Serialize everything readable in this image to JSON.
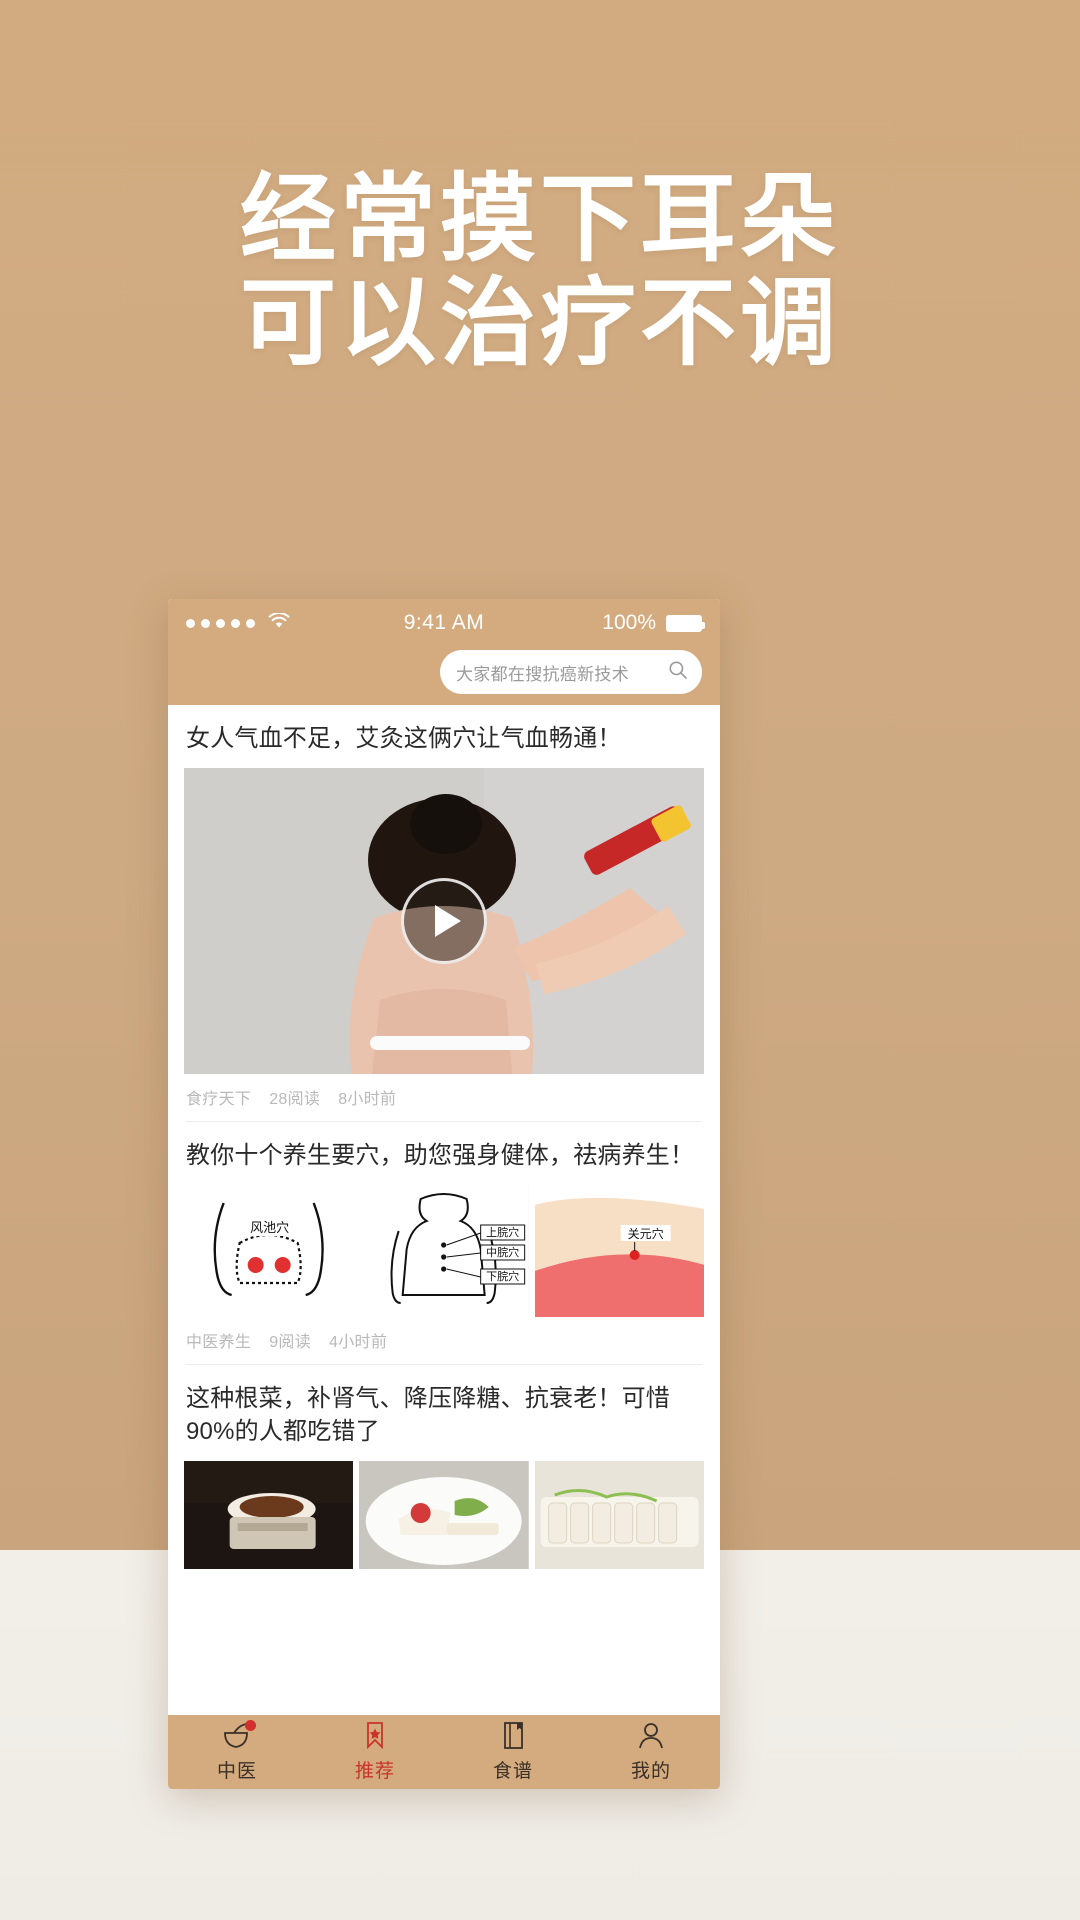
{
  "poster": {
    "headline_line1": "经常摸下耳朵",
    "headline_line2": "可以治疗不调",
    "bg_color": "#cda87f",
    "headline_color": "#ffffff"
  },
  "phone": {
    "statusbar": {
      "signal_dots": "•••••",
      "wifi_icon": "wifi-icon",
      "time": "9:41 AM",
      "battery_percent": "100%",
      "battery_icon": "battery-full-icon"
    },
    "search": {
      "placeholder": "大家都在搜抗癌新技术",
      "icon": "search-icon"
    },
    "accent_color": "#d4ab7e",
    "active_color": "#c8342a"
  },
  "feed": {
    "articles": [
      {
        "title": "女人气血不足，艾灸这俩穴让气血畅通！",
        "media_type": "video",
        "play_icon": "play-icon",
        "source": "食疗天下",
        "reads": "28阅读",
        "time": "8小时前"
      },
      {
        "title": "教你十个养生要穴，助您强身健体，祛病养生！",
        "media_type": "three-images",
        "image_labels": [
          "风池穴",
          "上脘穴 中脘穴 下脘穴",
          "关元穴"
        ],
        "source": "中医养生",
        "reads": "9阅读",
        "time": "4小时前"
      },
      {
        "title": "这种根菜，补肾气、降压降糖、抗衰老！可惜90%的人都吃错了",
        "media_type": "three-images",
        "source": "",
        "reads": "",
        "time": ""
      }
    ]
  },
  "tabbar": {
    "tabs": [
      {
        "label": "中医",
        "icon": "mortar-pestle-icon",
        "active": false,
        "badge": true
      },
      {
        "label": "推荐",
        "icon": "bookmark-star-icon",
        "active": true,
        "badge": false
      },
      {
        "label": "食谱",
        "icon": "book-icon",
        "active": false,
        "badge": false
      },
      {
        "label": "我的",
        "icon": "person-icon",
        "active": false,
        "badge": false
      }
    ]
  }
}
